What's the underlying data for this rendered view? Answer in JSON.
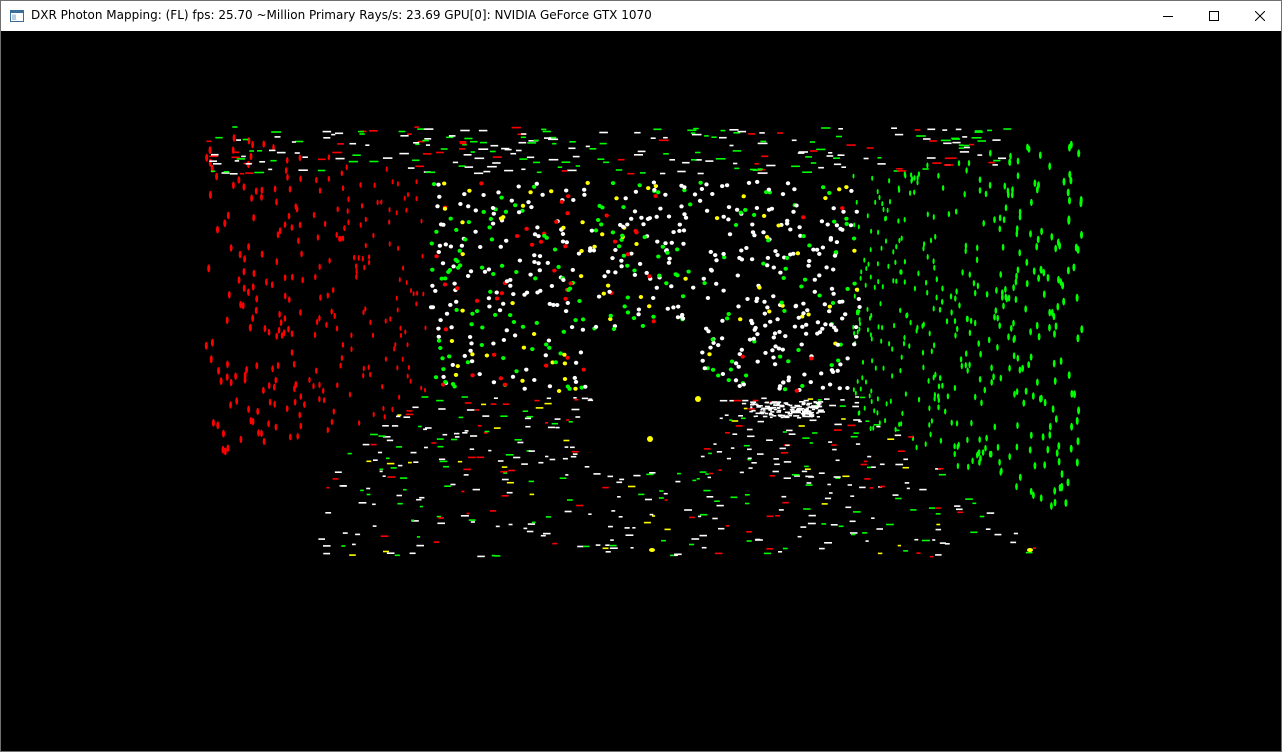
{
  "window": {
    "title": "DXR Photon Mapping: (FL)    fps: 25.70     ~Million Primary Rays/s: 23.69     GPU[0]: NVIDIA GeForce GTX 1070",
    "icons": {
      "app": "app-window-icon",
      "minimize": "minimize-icon",
      "maximize": "maximize-icon",
      "close": "close-icon"
    }
  },
  "scene": {
    "description_type": "photon-map-visualization",
    "colors": {
      "background": "#000000",
      "left_wall_photons": "#ff0000",
      "right_wall_photons": "#00ff00",
      "direct_photons": "#ffffff",
      "yellow_photons": "#ffff00"
    }
  }
}
